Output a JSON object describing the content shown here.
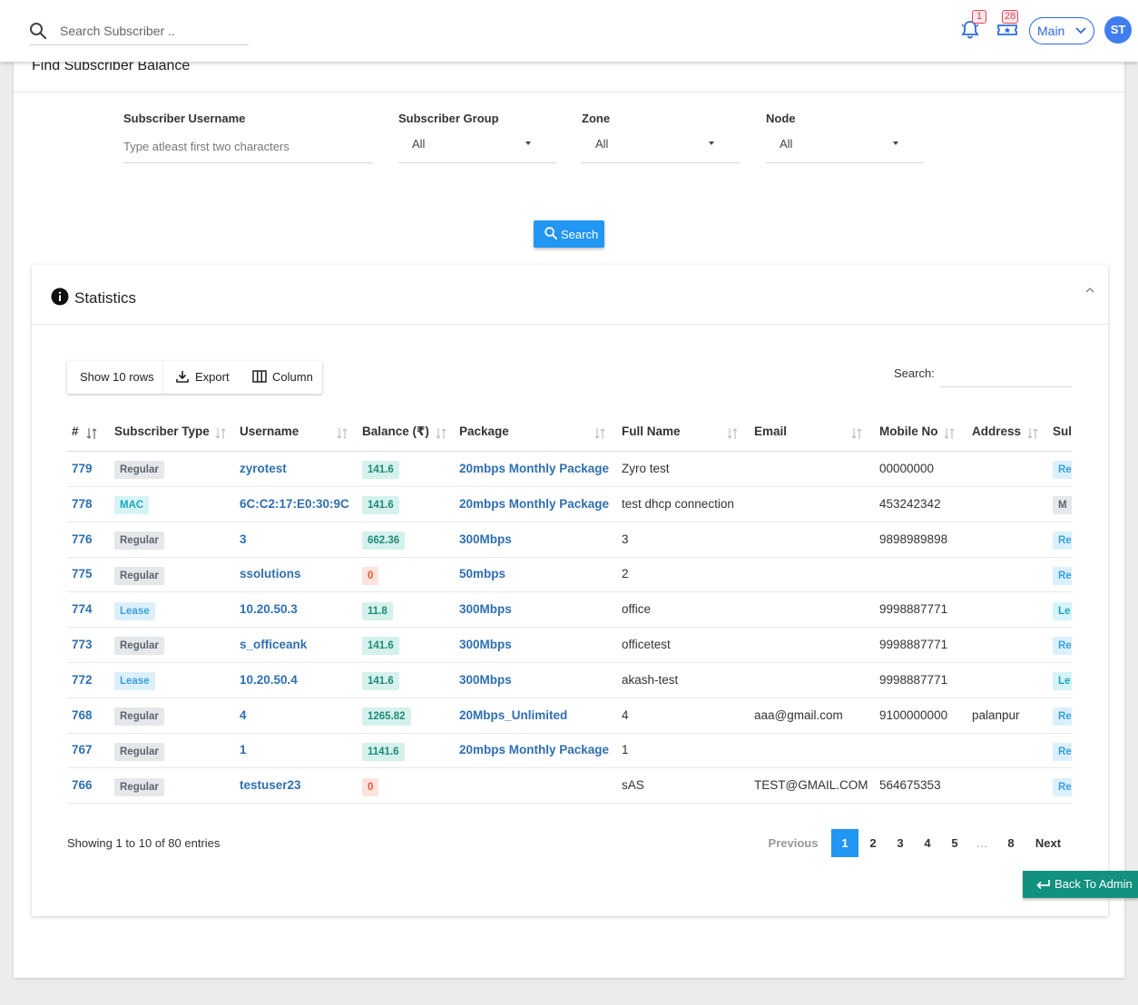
{
  "topbar": {
    "search_placeholder": "Search Subscriber ..",
    "notifications_count": "1",
    "tickets_count": "28",
    "main_select": "Main",
    "avatar_initials": "ST"
  },
  "page": {
    "title": "Find Subscriber Balance"
  },
  "filters": {
    "username_label": "Subscriber Username",
    "username_placeholder": "Type atleast first two characters",
    "group_label": "Subscriber Group",
    "group_value": "All",
    "zone_label": "Zone",
    "zone_value": "All",
    "node_label": "Node",
    "node_value": "All",
    "search_button": "Search"
  },
  "stats": {
    "title": "Statistics",
    "show_rows": "Show 10 rows",
    "export": "Export",
    "column": "Column",
    "search_label": "Search:"
  },
  "table": {
    "headers": [
      "#",
      "Subscriber Type",
      "Username",
      "Balance (₹)",
      "Package",
      "Full Name",
      "Email",
      "Mobile No",
      "Address",
      "Sul"
    ],
    "rows": [
      {
        "id": "779",
        "type": "Regular",
        "username": "zyrotest",
        "balance": "141.6",
        "package": "20mbps Monthly Package",
        "fullname": "Zyro test",
        "email": "",
        "mobile": "00000000",
        "address": "",
        "sub": "Re"
      },
      {
        "id": "778",
        "type": "MAC",
        "username": "6C:C2:17:E0:30:9C",
        "balance": "141.6",
        "package": "20mbps Monthly Package",
        "fullname": "test dhcp connection",
        "email": "",
        "mobile": "453242342",
        "address": "",
        "sub": "M"
      },
      {
        "id": "776",
        "type": "Regular",
        "username": "3",
        "balance": "662.36",
        "package": "300Mbps",
        "fullname": "3",
        "email": "",
        "mobile": "9898989898",
        "address": "",
        "sub": "Re"
      },
      {
        "id": "775",
        "type": "Regular",
        "username": "ssolutions",
        "balance": "0",
        "package": "50mbps",
        "fullname": "2",
        "email": "",
        "mobile": "",
        "address": "",
        "sub": "Re"
      },
      {
        "id": "774",
        "type": "Lease",
        "username": "10.20.50.3",
        "balance": "11.8",
        "package": "300Mbps",
        "fullname": "office",
        "email": "",
        "mobile": "9998887771",
        "address": "",
        "sub": "Le"
      },
      {
        "id": "773",
        "type": "Regular",
        "username": "s_officeank",
        "balance": "141.6",
        "package": "300Mbps",
        "fullname": "officetest",
        "email": "",
        "mobile": "9998887771",
        "address": "",
        "sub": "Re"
      },
      {
        "id": "772",
        "type": "Lease",
        "username": "10.20.50.4",
        "balance": "141.6",
        "package": "300Mbps",
        "fullname": "akash-test",
        "email": "",
        "mobile": "9998887771",
        "address": "",
        "sub": "Le"
      },
      {
        "id": "768",
        "type": "Regular",
        "username": "4",
        "balance": "1265.82",
        "package": "20Mbps_Unlimited",
        "fullname": "4",
        "email": "aaa@gmail.com",
        "mobile": "9100000000",
        "address": "palanpur",
        "sub": "Re"
      },
      {
        "id": "767",
        "type": "Regular",
        "username": "1",
        "balance": "1141.6",
        "package": "20mbps Monthly Package",
        "fullname": "1",
        "email": "",
        "mobile": "",
        "address": "",
        "sub": "Re"
      },
      {
        "id": "766",
        "type": "Regular",
        "username": "testuser23",
        "balance": "0",
        "package": "",
        "fullname": "sAS",
        "email": "TEST@GMAIL.COM",
        "mobile": "564675353",
        "address": "",
        "sub": "Re"
      }
    ]
  },
  "footer": {
    "showing": "Showing 1 to 10 of 80 entries",
    "previous": "Previous",
    "pages": [
      "1",
      "2",
      "3",
      "4",
      "5",
      "…",
      "8"
    ],
    "next": "Next",
    "back_to_admin": "Back To Admin"
  },
  "colors": {
    "accent": "#2196f3",
    "link": "#2f6fb0",
    "back_button": "#13917f"
  }
}
